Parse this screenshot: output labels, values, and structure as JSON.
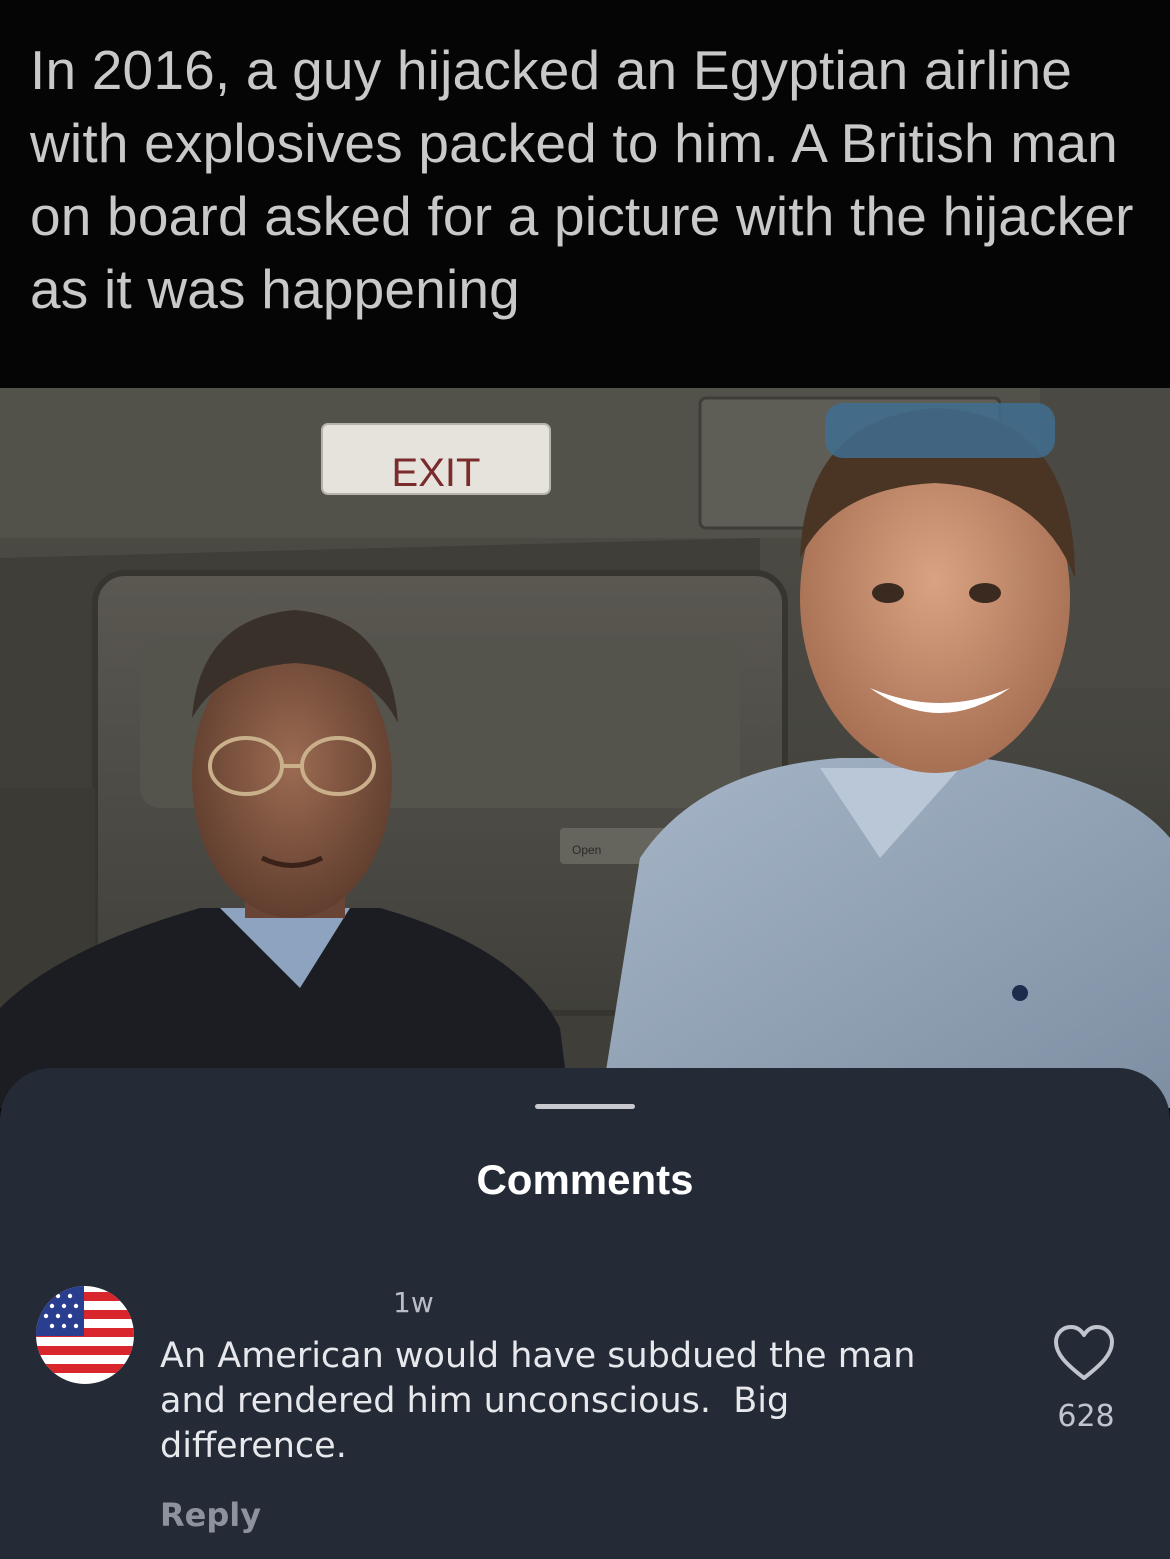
{
  "post": {
    "caption": "In 2016, a guy hijacked an Egyptian airline with explosives packed to him. A British man on board asked for a picture with the hijacker as it was happening",
    "image": {
      "exit_sign": "EXIT",
      "panel_label": "Open"
    }
  },
  "comments_sheet": {
    "title": "Comments",
    "comments": [
      {
        "avatar": "us-flag-avatar",
        "timestamp": "1w",
        "text": "An American would have subdued the man\nand rendered him unconscious.  Big\ndifference.",
        "reply_label": "Reply",
        "like_icon": "heart-outline-icon",
        "like_count": "628"
      }
    ]
  },
  "colors": {
    "sheet_background": "#242a36",
    "caption_text": "#c9c9c9",
    "caption_background": "#050505"
  }
}
